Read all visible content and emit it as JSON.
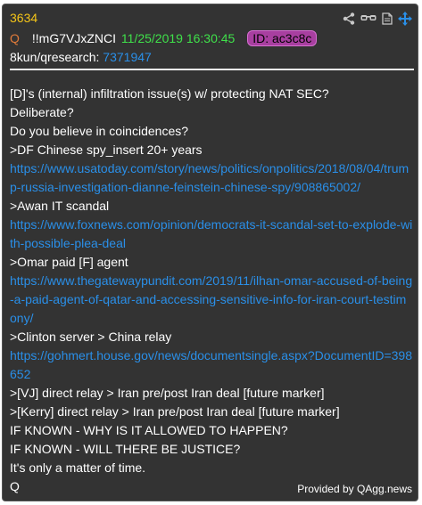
{
  "post": {
    "number": "3634",
    "q_mark": "Q",
    "tripcode": "!!mG7VJxZNCI",
    "date": "11/25/2019 16:30:45",
    "id_label": "ID: ac3c8c",
    "source": "8kun/qresearch:",
    "source_ref": "7371947"
  },
  "icons": [
    "share-icon",
    "glasses-icon",
    "document-icon",
    "move-icon"
  ],
  "body_lines": [
    {
      "text": "[D]'s (internal) infiltration issue(s) w/ protecting NAT SEC?",
      "type": "text"
    },
    {
      "text": "Deliberate?",
      "type": "text"
    },
    {
      "text": "Do you believe in coincidences?",
      "type": "text"
    },
    {
      "text": ">DF Chinese spy_insert 20+ years",
      "type": "text"
    },
    {
      "text": "https://www.usatoday.com/story/news/politics/onpolitics/2018/08/04/trump-russia-investigation-dianne-feinstein-chinese-spy/908865002/",
      "type": "link"
    },
    {
      "text": ">Awan IT scandal",
      "type": "text"
    },
    {
      "text": "https://www.foxnews.com/opinion/democrats-it-scandal-set-to-explode-with-possible-plea-deal",
      "type": "link"
    },
    {
      "text": ">Omar paid [F] agent",
      "type": "text"
    },
    {
      "text": "https://www.thegatewaypundit.com/2019/11/ilhan-omar-accused-of-being-a-paid-agent-of-qatar-and-accessing-sensitive-info-for-iran-court-testimony/",
      "type": "link"
    },
    {
      "text": ">Clinton server > China relay",
      "type": "text"
    },
    {
      "text": "https://gohmert.house.gov/news/documentsingle.aspx?DocumentID=398652",
      "type": "link"
    },
    {
      "text": ">[VJ] direct relay > Iran pre/post Iran deal [future marker]",
      "type": "text"
    },
    {
      "text": ">[Kerry] direct relay > Iran pre/post Iran deal [future marker]",
      "type": "text"
    },
    {
      "text": "IF KNOWN - WHY IS IT ALLOWED TO HAPPEN?",
      "type": "text"
    },
    {
      "text": "IF KNOWN - WILL THERE BE JUSTICE?",
      "type": "text"
    },
    {
      "text": "It's only a matter of time.",
      "type": "text"
    },
    {
      "text": "Q",
      "type": "text"
    }
  ],
  "credit": "Provided by QAgg.news",
  "colors": {
    "card_bg": "#333333",
    "post_number": "#f5c518",
    "date": "#3fe04a",
    "link": "#2a8fe8",
    "id_badge": "#a83fa0",
    "q_mark": "#e07b3a"
  }
}
